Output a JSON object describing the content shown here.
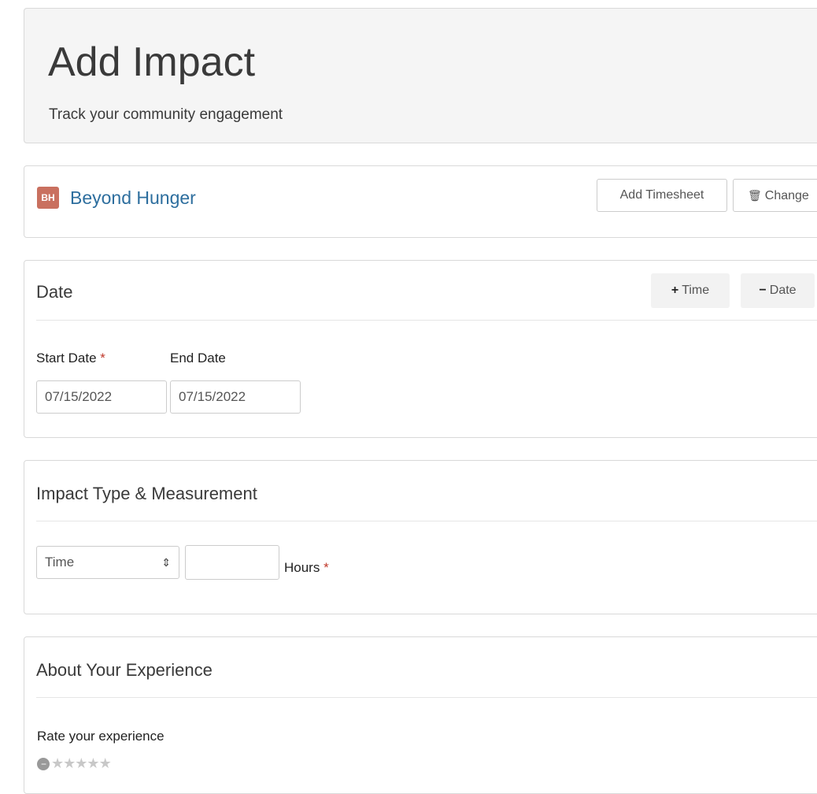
{
  "header": {
    "title": "Add Impact",
    "subtitle": "Track your community engagement"
  },
  "org": {
    "logo_text": "BH",
    "name": "Beyond Hunger",
    "add_timesheet_label": "Add Timesheet",
    "change_label": "Change",
    "change_icon": "trash-icon"
  },
  "date_section": {
    "title": "Date",
    "add_time_label": "Time",
    "remove_date_label": "Date",
    "start_date_label": "Start Date",
    "required_marker": "*",
    "end_date_label": "End Date",
    "start_date_value": "07/15/2022",
    "end_date_value": "07/15/2022"
  },
  "impact_section": {
    "title": "Impact Type & Measurement",
    "type_selected": "Time",
    "hours_value": "",
    "hours_label": "Hours",
    "required_marker": "*"
  },
  "experience_section": {
    "title": "About Your Experience",
    "rate_label": "Rate your experience",
    "rating": 0,
    "max_rating": 6
  },
  "colors": {
    "link": "#2d6e9e",
    "required": "#c0392b",
    "logo_bg": "#c9705f"
  }
}
